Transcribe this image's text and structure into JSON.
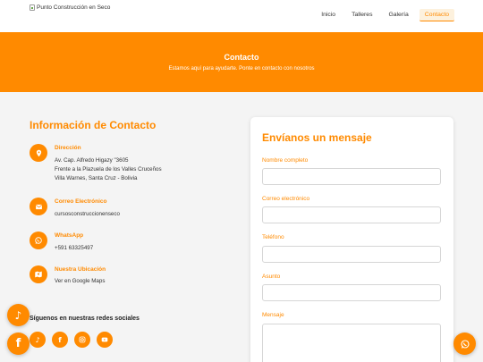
{
  "header": {
    "logo_alt": "Punto Construcción en Seco",
    "nav": [
      {
        "label": "Inicio"
      },
      {
        "label": "Talleres"
      },
      {
        "label": "Galería"
      },
      {
        "label": "Contacto",
        "active": true
      }
    ]
  },
  "hero": {
    "title": "Contacto",
    "subtitle": "Estamos aquí para ayudarte. Ponte en contacto con nosotros"
  },
  "info": {
    "title": "Información de Contacto",
    "address": {
      "label": "Dirección",
      "line1": "Av. Cap. Alfredo Higazy \"3605",
      "line2": "Frente a la Plazuela de los Valles Cruceños",
      "line3": "Villa Warnes, Santa Cruz - Bolivia",
      "icon": "map-pin-icon"
    },
    "email": {
      "label": "Correo Electrónico",
      "value": "cursosconstruccionenseco",
      "icon": "envelope-icon"
    },
    "whatsapp": {
      "label": "WhatsApp",
      "value": "+591 63325497",
      "icon": "whatsapp-icon"
    },
    "location": {
      "label": "Nuestra Ubicación",
      "link": "Ver en Google Maps",
      "icon": "map-icon"
    }
  },
  "social": {
    "title": "Síguenos en nuestras redes sociales",
    "icons": [
      "tiktok-icon",
      "facebook-icon",
      "instagram-icon",
      "youtube-icon"
    ]
  },
  "form": {
    "title": "Envíanos un mensaje",
    "fields": {
      "name": {
        "label": "Nombre completo",
        "value": "",
        "placeholder": ""
      },
      "email": {
        "label": "Correo electrónico",
        "value": "",
        "placeholder": ""
      },
      "phone": {
        "label": "Teléfono",
        "value": "",
        "placeholder": ""
      },
      "subject": {
        "label": "Asunto",
        "value": "",
        "placeholder": ""
      },
      "message": {
        "label": "Mensaje",
        "value": "",
        "placeholder": ""
      }
    }
  },
  "floating": {
    "left": [
      "tiktok-icon",
      "facebook-icon"
    ],
    "right": [
      "whatsapp-icon"
    ]
  },
  "colors": {
    "accent": "#ff8a00",
    "page_bg": "#f4f4f4",
    "header_bg": "#ffffff"
  }
}
